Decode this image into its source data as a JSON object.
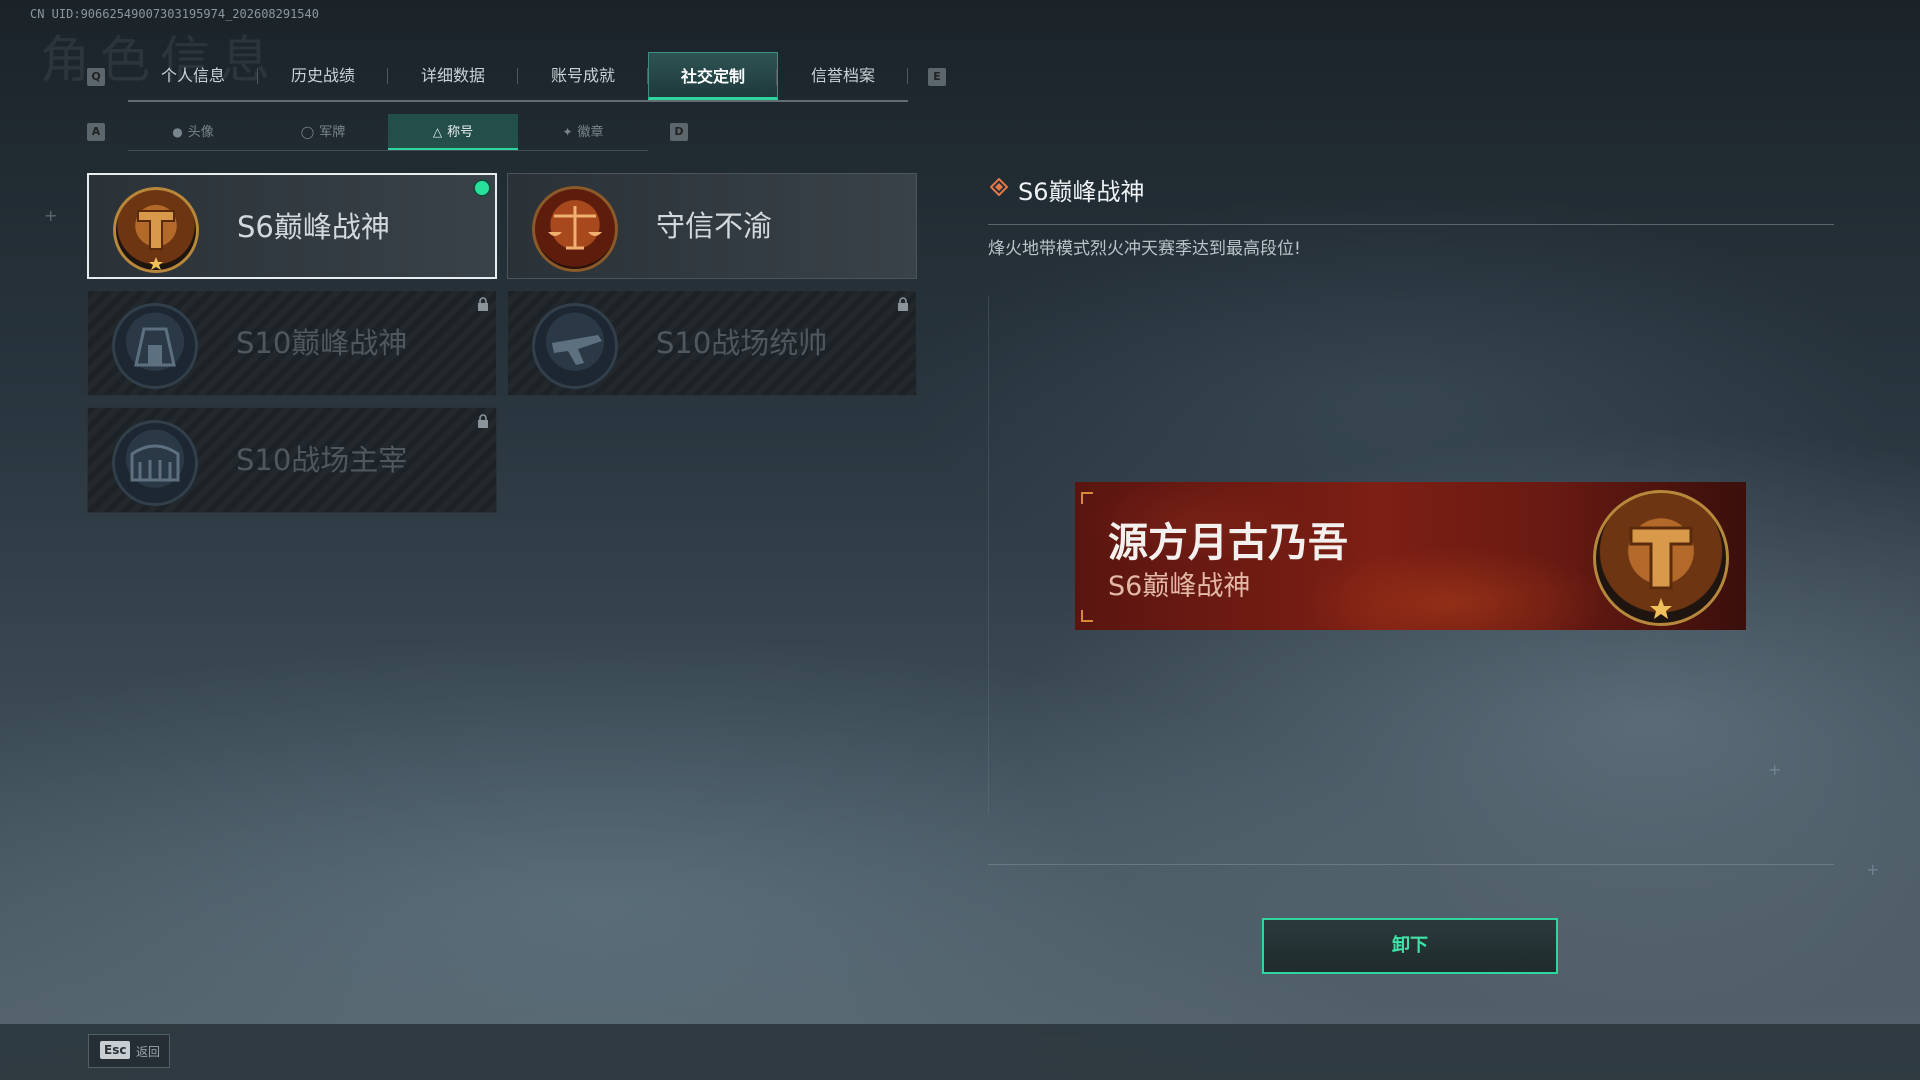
{
  "uid_text": "CN UID:906625490073031959​74_202608291540",
  "ghost_title": "角色信息",
  "top_tabs": {
    "left_key": "Q",
    "right_key": "E",
    "items": [
      {
        "label": "个人信息"
      },
      {
        "label": "历史战绩"
      },
      {
        "label": "详细数据"
      },
      {
        "label": "账号成就"
      },
      {
        "label": "社交定制",
        "active": true
      },
      {
        "label": "信誉档案"
      }
    ]
  },
  "sub_tabs": {
    "left_key": "A",
    "right_key": "D",
    "items": [
      {
        "label": "头像",
        "icon": "person-icon"
      },
      {
        "label": "军牌",
        "icon": "dogtag-icon"
      },
      {
        "label": "称号",
        "icon": "triangle-icon",
        "active": true
      },
      {
        "label": "徽章",
        "icon": "emblem-icon"
      }
    ]
  },
  "titles": [
    {
      "name": "S6巅峰战神",
      "locked": false,
      "selected": true,
      "equipped": true,
      "badge": "gold-emblem"
    },
    {
      "name": "守信不渝",
      "locked": false,
      "selected": false,
      "badge": "scales-emblem"
    },
    {
      "name": "S10巅峰战神",
      "locked": true,
      "badge": "building-emblem"
    },
    {
      "name": "S10战场统帅",
      "locked": true,
      "badge": "aircraft-emblem"
    },
    {
      "name": "S10战场主宰",
      "locked": true,
      "badge": "colosseum-emblem"
    }
  ],
  "detail": {
    "title": "S6巅峰战神",
    "description": "烽火地带模式烈火冲天赛季达到最高段位!"
  },
  "preview": {
    "player_name": "源方月古乃吾",
    "title": "S6巅峰战神"
  },
  "actions": {
    "unequip_label": "卸下"
  },
  "footer": {
    "esc_key": "Esc",
    "back_label": "返回"
  },
  "colors": {
    "accent_green": "#2fd59c",
    "plate_red": "#7d1f14",
    "badge_gold": "#b7873b"
  }
}
